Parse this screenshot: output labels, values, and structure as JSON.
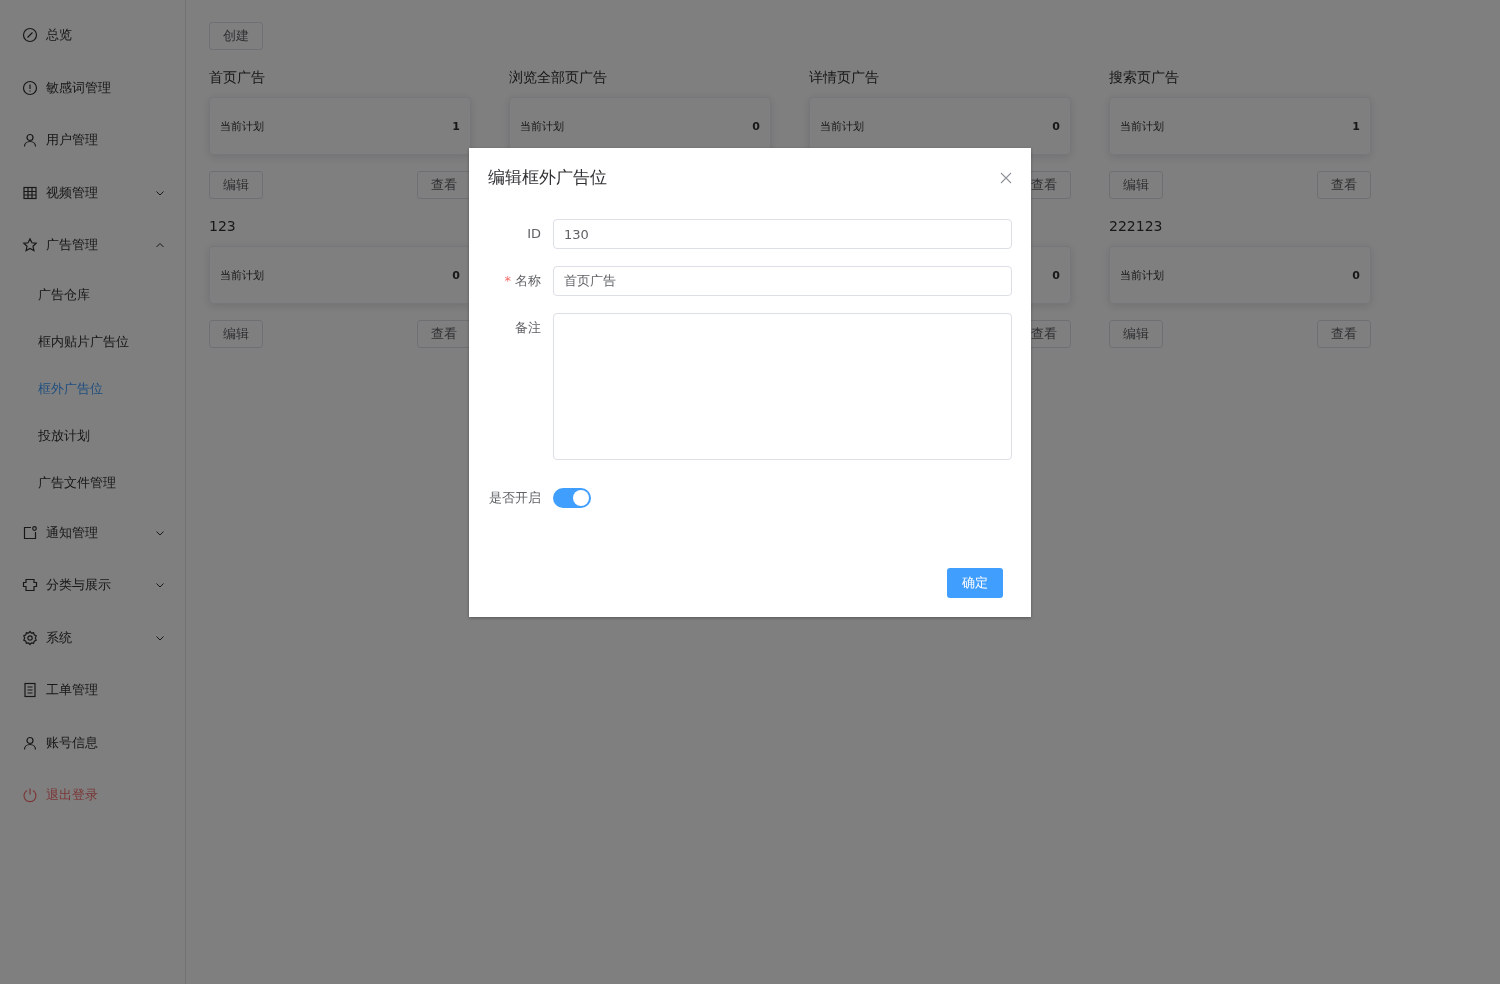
{
  "sidebar": {
    "items": [
      {
        "label": "总览",
        "kind": "top",
        "selected": false
      },
      {
        "label": "敏感词管理",
        "kind": "top",
        "selected": false
      },
      {
        "label": "用户管理",
        "kind": "top",
        "selected": false
      },
      {
        "label": "视频管理",
        "kind": "top",
        "selected": false,
        "expanded": false
      },
      {
        "label": "广告管理",
        "kind": "top",
        "selected": false,
        "expanded": true
      },
      {
        "label": "广告仓库",
        "kind": "sub",
        "selected": false
      },
      {
        "label": "框内贴片广告位",
        "kind": "sub",
        "selected": false
      },
      {
        "label": "框外广告位",
        "kind": "sub",
        "selected": true
      },
      {
        "label": "投放计划",
        "kind": "sub",
        "selected": false
      },
      {
        "label": "广告文件管理",
        "kind": "sub",
        "selected": false
      },
      {
        "label": "通知管理",
        "kind": "top",
        "selected": false,
        "expanded": false
      },
      {
        "label": "分类与展示",
        "kind": "top",
        "selected": false,
        "expanded": false
      },
      {
        "label": "系统",
        "kind": "top",
        "selected": false,
        "expanded": false
      },
      {
        "label": "工单管理",
        "kind": "top",
        "selected": false
      },
      {
        "label": "账号信息",
        "kind": "top",
        "selected": false
      },
      {
        "label": "退出登录",
        "kind": "danger",
        "selected": false
      }
    ]
  },
  "create_button": "创建",
  "ad_slots": [
    {
      "title": "首页广告",
      "plan_label": "当前计划",
      "plan_value": "1",
      "edit": "编辑",
      "view": "查看"
    },
    {
      "title": "浏览全部页广告",
      "plan_label": "当前计划",
      "plan_value": "0"
    },
    {
      "title": "详情页广告",
      "plan_label": "当前计划",
      "plan_value": "0",
      "view": "查看"
    },
    {
      "title": "搜索页广告",
      "plan_label": "当前计划",
      "plan_value": "1",
      "edit": "编辑",
      "view": "查看"
    },
    {
      "title": "123",
      "plan_label": "当前计划",
      "plan_value": "0",
      "edit": "编辑",
      "view": "查看"
    },
    {
      "plan_value": "0",
      "view": "查看"
    },
    {
      "title": "222123",
      "plan_label": "当前计划",
      "plan_value": "0",
      "edit": "编辑",
      "view": "查看"
    }
  ],
  "dialog": {
    "title": "编辑框外广告位",
    "fields": [
      {
        "kind": "input",
        "label": "ID",
        "value": "130"
      },
      {
        "kind": "input",
        "label": "名称",
        "required_mark": "*",
        "value": "首页广告"
      },
      {
        "kind": "textarea",
        "label": "备注"
      },
      {
        "kind": "switch",
        "label": "是否开启",
        "on": true
      }
    ],
    "confirm_button": "确定"
  }
}
